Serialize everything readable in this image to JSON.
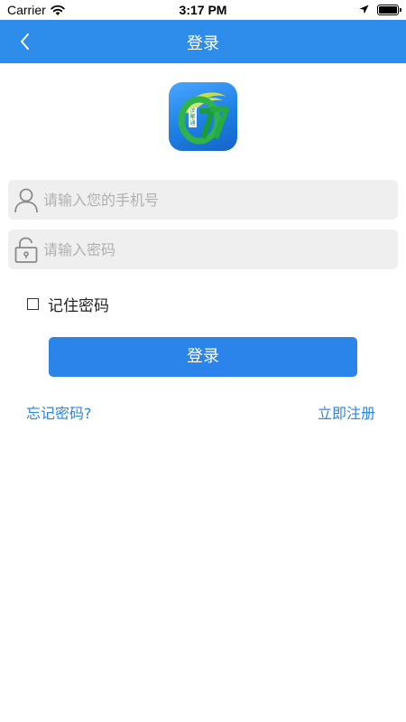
{
  "status_bar": {
    "carrier": "Carrier",
    "time": "3:17 PM"
  },
  "nav": {
    "title": "登录"
  },
  "login_form": {
    "phone_placeholder": "请输入您的手机号",
    "phone_value": "",
    "password_placeholder": "请输入密码",
    "password_value": "",
    "remember_label": "记住密码",
    "remember_checked": false,
    "submit_label": "登录"
  },
  "links": {
    "forgot_password": "忘记密码?",
    "register": "立即注册"
  },
  "logo": {
    "text": "汶聚通"
  },
  "colors": {
    "nav_background": "#2e8ceb",
    "primary_button": "#2a84ea",
    "link": "#2a84ea",
    "input_background": "#efefef"
  },
  "icons": {
    "back": "chevron-left-icon",
    "phone_field": "user-icon",
    "password_field": "lock-icon",
    "status_wifi": "wifi-icon",
    "status_location": "location-arrow-icon",
    "status_battery": "battery-icon"
  }
}
